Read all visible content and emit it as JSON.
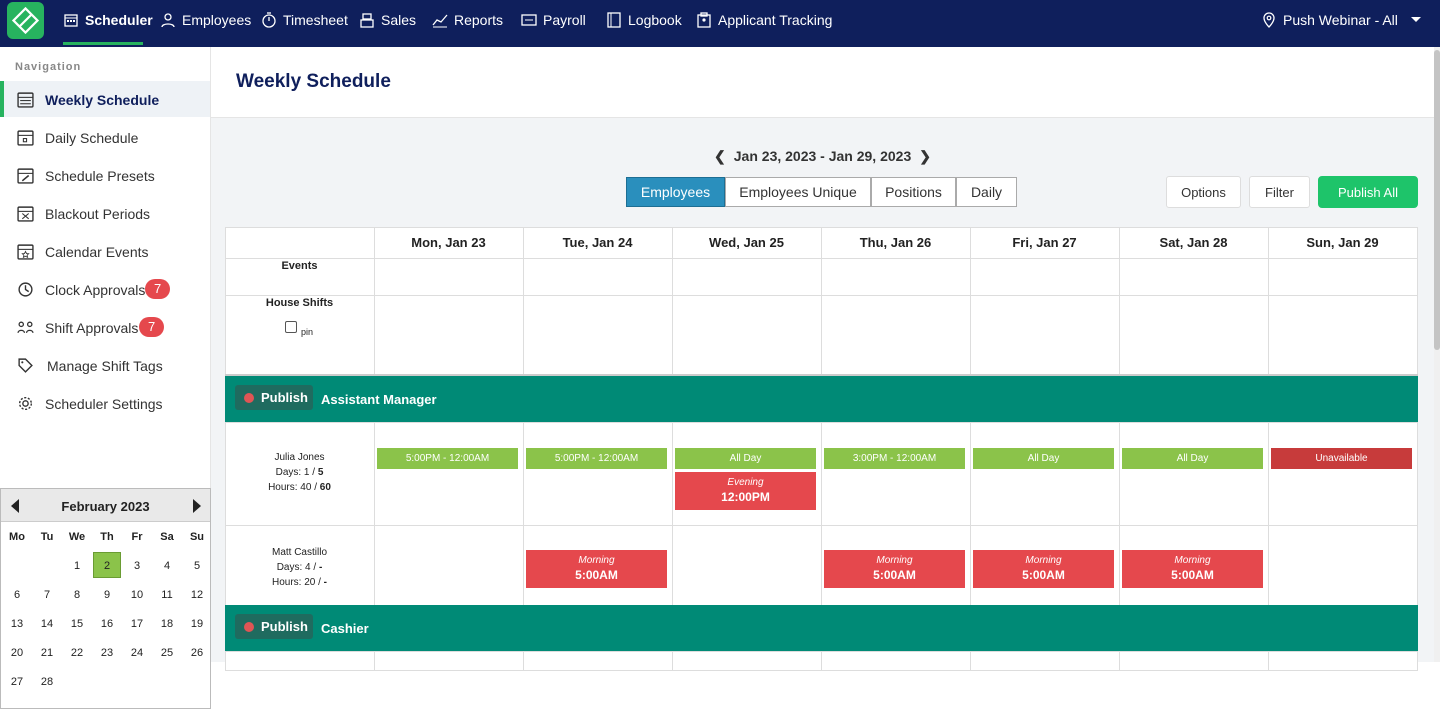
{
  "topbar": {
    "nav": [
      {
        "label": "Scheduler",
        "icon": "calendar-icon",
        "active": true
      },
      {
        "label": "Employees",
        "icon": "user-icon"
      },
      {
        "label": "Timesheet",
        "icon": "stopwatch-icon"
      },
      {
        "label": "Sales",
        "icon": "register-icon"
      },
      {
        "label": "Reports",
        "icon": "chart-line-icon"
      },
      {
        "label": "Payroll",
        "icon": "money-icon"
      },
      {
        "label": "Logbook",
        "icon": "book-icon"
      },
      {
        "label": "Applicant Tracking",
        "icon": "clipboard-icon"
      }
    ],
    "location": "Push Webinar - All"
  },
  "sidebar": {
    "heading": "Navigation",
    "items": [
      {
        "label": "Weekly Schedule",
        "icon": "calendar-week-icon",
        "active": true
      },
      {
        "label": "Daily Schedule",
        "icon": "calendar-day-icon"
      },
      {
        "label": "Schedule Presets",
        "icon": "calendar-edit-icon"
      },
      {
        "label": "Blackout Periods",
        "icon": "calendar-x-icon"
      },
      {
        "label": "Calendar Events",
        "icon": "calendar-event-icon"
      },
      {
        "label": "Clock Approvals",
        "icon": "clock-icon",
        "badge": "7"
      },
      {
        "label": "Shift Approvals",
        "icon": "people-swap-icon",
        "badge": "7"
      },
      {
        "label": "Manage Shift Tags",
        "icon": "tag-icon"
      },
      {
        "label": "Scheduler Settings",
        "icon": "gear-icon"
      }
    ]
  },
  "minical": {
    "title": "February 2023",
    "dow": [
      "Mo",
      "Tu",
      "We",
      "Th",
      "Fr",
      "Sa",
      "Su"
    ],
    "weeks": [
      [
        "",
        "",
        "1",
        "2",
        "3",
        "4",
        "5"
      ],
      [
        "6",
        "7",
        "8",
        "9",
        "10",
        "11",
        "12"
      ],
      [
        "13",
        "14",
        "15",
        "16",
        "17",
        "18",
        "19"
      ],
      [
        "20",
        "21",
        "22",
        "23",
        "24",
        "25",
        "26"
      ],
      [
        "27",
        "28",
        "",
        "",
        "",
        "",
        ""
      ]
    ],
    "selected": "2"
  },
  "page": {
    "title": "Weekly Schedule"
  },
  "schedule": {
    "date_range": "Jan 23, 2023 - Jan 29, 2023",
    "views": [
      "Employees",
      "Employees Unique",
      "Positions",
      "Daily"
    ],
    "active_view": "Employees",
    "options_label": "Options",
    "filter_label": "Filter",
    "publish_all_label": "Publish All",
    "days": [
      "Mon, Jan 23",
      "Tue, Jan 24",
      "Wed, Jan 25",
      "Thu, Jan 26",
      "Fri, Jan 27",
      "Sat, Jan 28",
      "Sun, Jan 29"
    ],
    "events_label": "Events",
    "house_shifts_label": "House Shifts",
    "pin_label": "pin",
    "publish_label": "Publish",
    "positions": [
      {
        "name": "Assistant Manager",
        "employees": [
          {
            "name": "Julia Jones",
            "days": "Days: 1 / ",
            "days_max": "5",
            "hours": "Hours: 40 / ",
            "hours_max": "60",
            "shifts": [
              [
                {
                  "type": "g",
                  "text": "5:00PM - 12:00AM"
                }
              ],
              [
                {
                  "type": "g",
                  "text": "5:00PM - 12:00AM"
                }
              ],
              [
                {
                  "type": "g",
                  "text": "All Day"
                },
                {
                  "type": "r",
                  "tag": "Evening",
                  "time": "12:00PM"
                }
              ],
              [
                {
                  "type": "g",
                  "text": "3:00PM - 12:00AM"
                }
              ],
              [
                {
                  "type": "g",
                  "text": "All Day"
                }
              ],
              [
                {
                  "type": "g",
                  "text": "All Day"
                }
              ],
              [
                {
                  "type": "u",
                  "text": "Unavailable"
                }
              ]
            ]
          },
          {
            "name": "Matt Castillo",
            "days": "Days: 4 / ",
            "days_max": "-",
            "hours": "Hours: 20 / ",
            "hours_max": "-",
            "shifts": [
              [],
              [
                {
                  "type": "r",
                  "tag": "Morning",
                  "time": "5:00AM"
                }
              ],
              [],
              [
                {
                  "type": "r",
                  "tag": "Morning",
                  "time": "5:00AM"
                }
              ],
              [
                {
                  "type": "r",
                  "tag": "Morning",
                  "time": "5:00AM"
                }
              ],
              [
                {
                  "type": "r",
                  "tag": "Morning",
                  "time": "5:00AM"
                }
              ],
              []
            ]
          }
        ]
      },
      {
        "name": "Cashier",
        "employees": []
      }
    ]
  },
  "colors": {
    "nav": "#0f1f5c",
    "brand_green": "#27b35f",
    "position_bar": "#008a76",
    "shift_green": "#8bc34a",
    "shift_red": "#e5484d",
    "active_tab": "#2a8fbd"
  }
}
